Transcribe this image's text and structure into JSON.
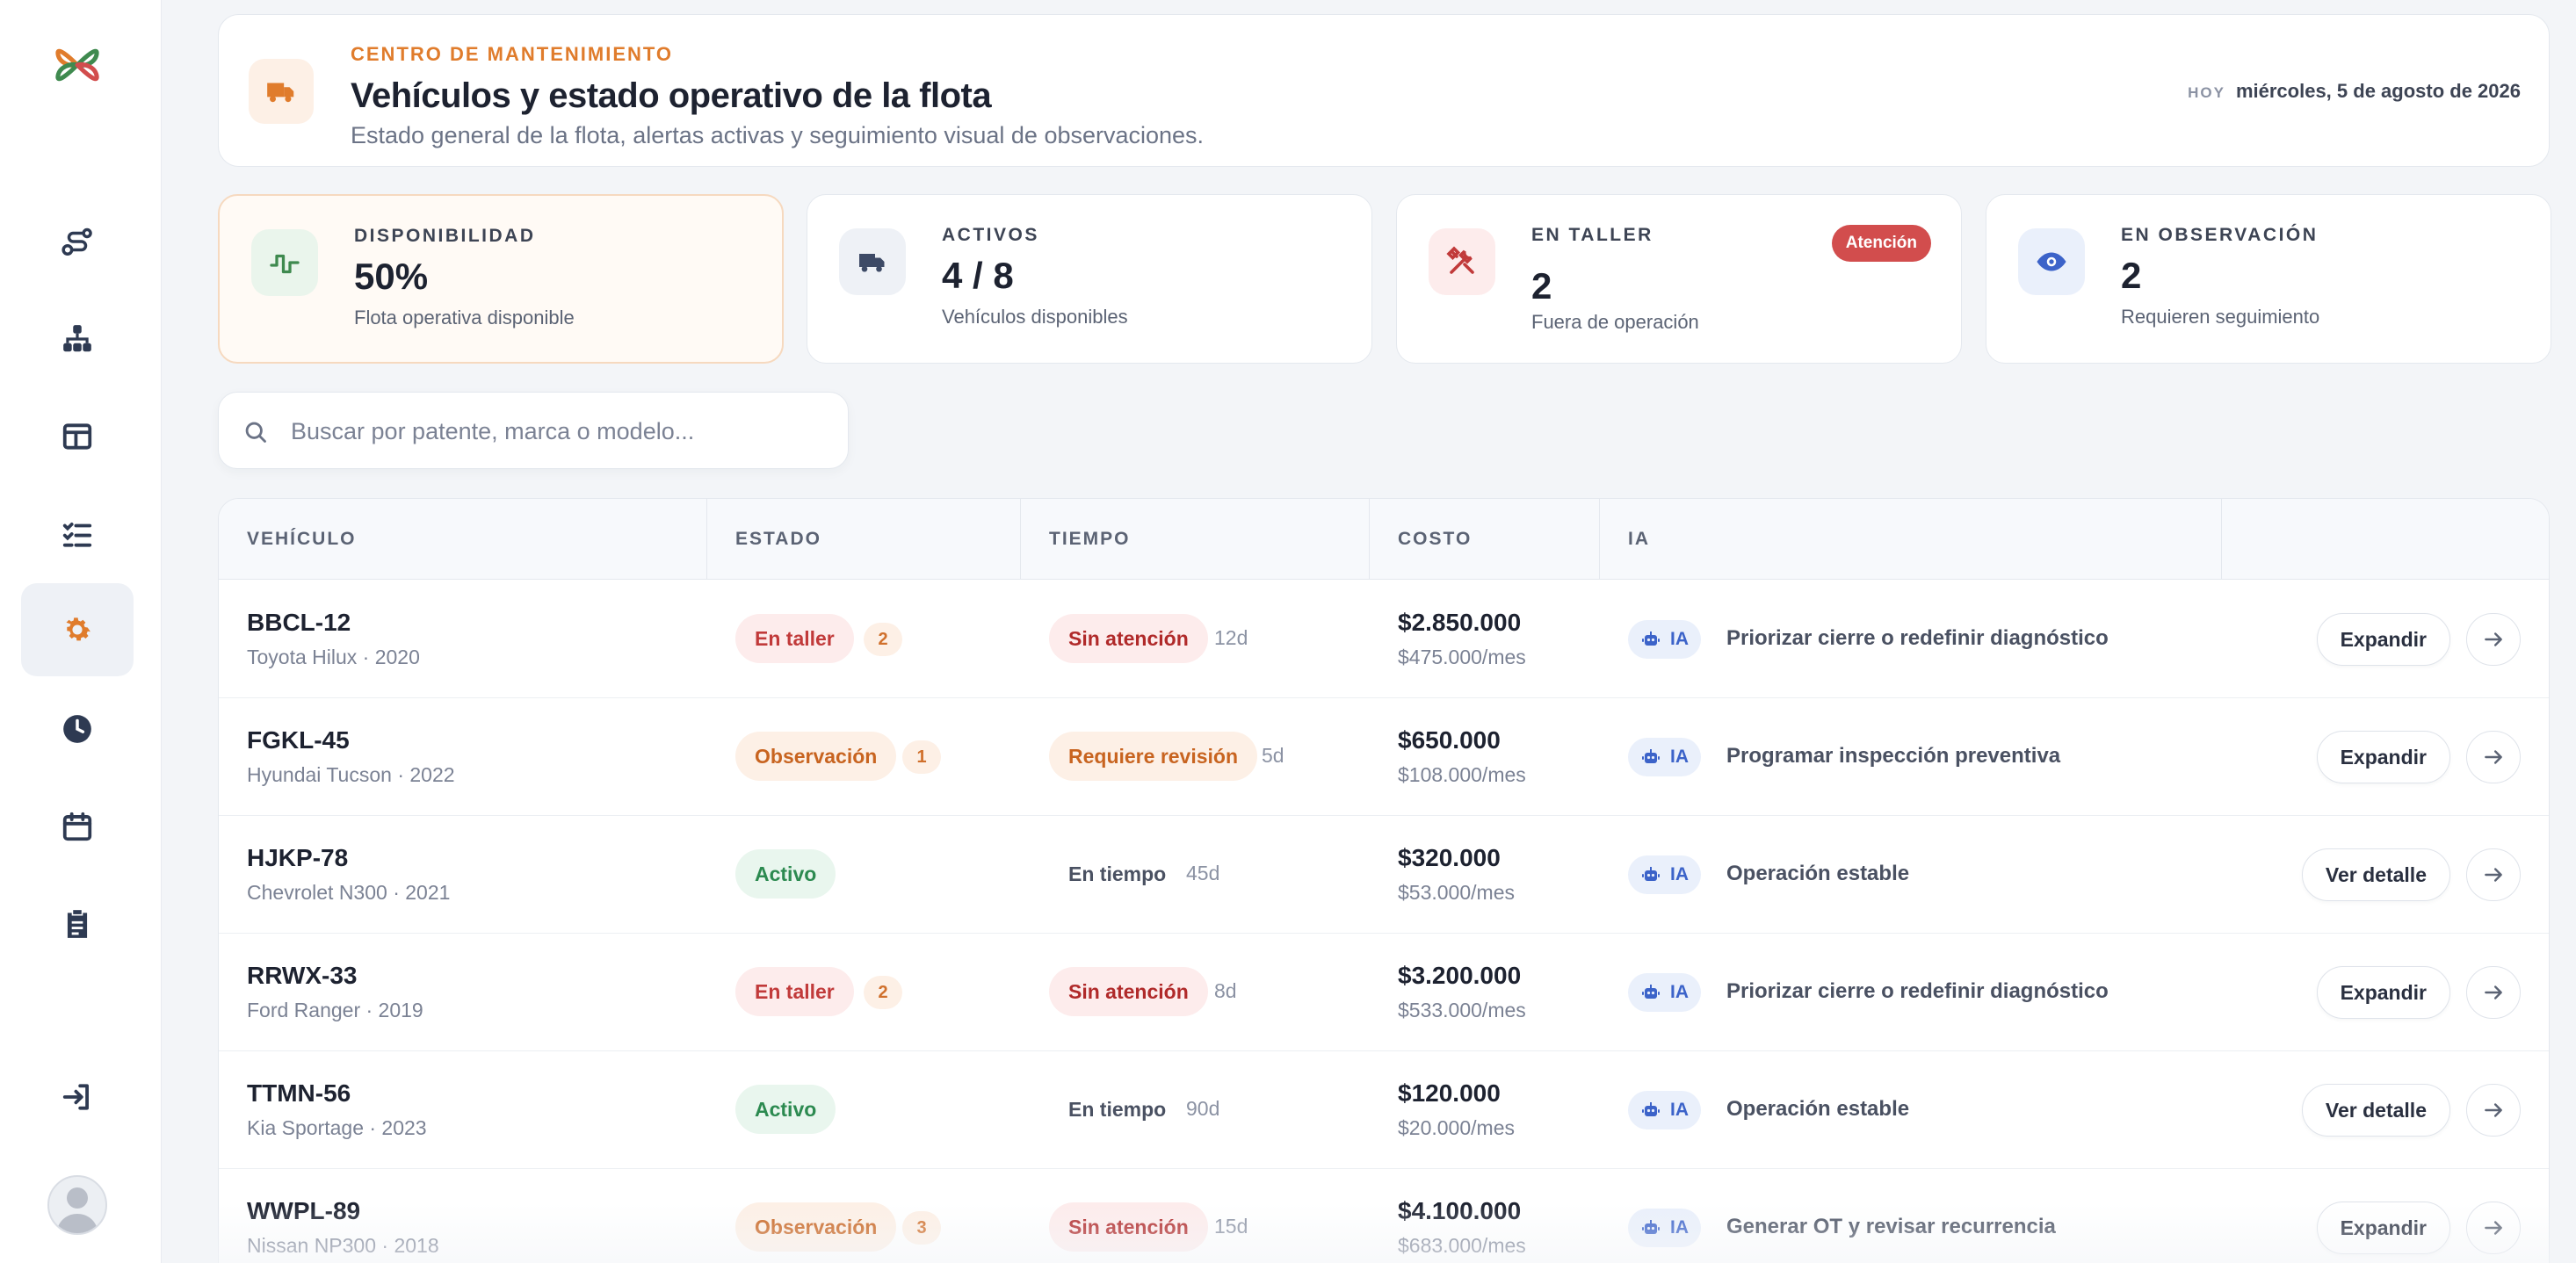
{
  "header": {
    "eyebrow": "CENTRO DE MANTENIMIENTO",
    "title": "Vehículos y estado operativo de la flota",
    "subtitle": "Estado general de la flota, alertas activas y seguimiento visual de observaciones.",
    "date_label": "HOY",
    "date_value": "miércoles, 5 de agosto de 2026"
  },
  "kpis": [
    {
      "label": "DISPONIBILIDAD",
      "value": "50%",
      "desc": "Flota operativa disponible",
      "icon": "pulse-icon"
    },
    {
      "label": "ACTIVOS",
      "value": "4 / 8",
      "desc": "Vehículos disponibles",
      "icon": "truck-icon"
    },
    {
      "label": "EN TALLER",
      "value": "2",
      "desc": "Fuera de operación",
      "badge": "Atención",
      "icon": "tools-icon"
    },
    {
      "label": "EN OBSERVACIÓN",
      "value": "2",
      "desc": "Requieren seguimiento",
      "icon": "eye-icon"
    }
  ],
  "search": {
    "placeholder": "Buscar por patente, marca o modelo..."
  },
  "table": {
    "columns": [
      "VEHÍCULO",
      "ESTADO",
      "TIEMPO",
      "COSTO",
      "IA",
      ""
    ],
    "ia_chip": "IA",
    "rows": [
      {
        "plate": "BBCL-12",
        "model": "Toyota Hilux · 2020",
        "status": "En taller",
        "status_type": "taller",
        "count": "2",
        "time": "Sin atención",
        "time_type": "sinat",
        "days": "12d",
        "cost": "$2.850.000",
        "monthly": "$475.000/mes",
        "ia": "Priorizar cierre o redefinir diagnóstico",
        "action": "Expandir"
      },
      {
        "plate": "FGKL-45",
        "model": "Hyundai Tucson · 2022",
        "status": "Observación",
        "status_type": "obs",
        "count": "1",
        "time": "Requiere revisión",
        "time_type": "reqrev",
        "days": "5d",
        "cost": "$650.000",
        "monthly": "$108.000/mes",
        "ia": "Programar inspección preventiva",
        "action": "Expandir"
      },
      {
        "plate": "HJKP-78",
        "model": "Chevrolet N300 · 2021",
        "status": "Activo",
        "status_type": "activo",
        "count": "",
        "time": "En tiempo",
        "time_type": "entiempo",
        "days": "45d",
        "cost": "$320.000",
        "monthly": "$53.000/mes",
        "ia": "Operación estable",
        "action": "Ver detalle"
      },
      {
        "plate": "RRWX-33",
        "model": "Ford Ranger · 2019",
        "status": "En taller",
        "status_type": "taller",
        "count": "2",
        "time": "Sin atención",
        "time_type": "sinat",
        "days": "8d",
        "cost": "$3.200.000",
        "monthly": "$533.000/mes",
        "ia": "Priorizar cierre o redefinir diagnóstico",
        "action": "Expandir"
      },
      {
        "plate": "TTMN-56",
        "model": "Kia Sportage · 2023",
        "status": "Activo",
        "status_type": "activo",
        "count": "",
        "time": "En tiempo",
        "time_type": "entiempo",
        "days": "90d",
        "cost": "$120.000",
        "monthly": "$20.000/mes",
        "ia": "Operación estable",
        "action": "Ver detalle"
      },
      {
        "plate": "WWPL-89",
        "model": "Nissan NP300 · 2018",
        "status": "Observación",
        "status_type": "obs",
        "count": "3",
        "time": "Sin atención",
        "time_type": "sinat",
        "days": "15d",
        "cost": "$4.100.000",
        "monthly": "$683.000/mes",
        "ia": "Generar OT y revisar recurrencia",
        "action": "Expandir"
      }
    ]
  },
  "colors": {
    "accent": "#e07c2c",
    "danger": "#d24d4d",
    "success": "#2c8a50",
    "ia": "#3c63c9"
  }
}
